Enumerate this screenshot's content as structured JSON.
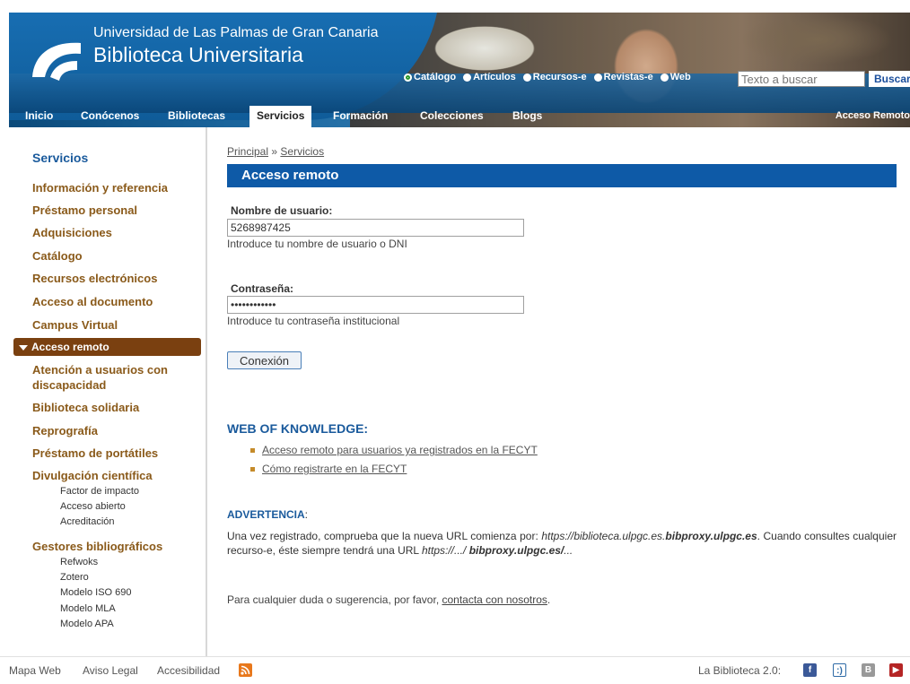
{
  "header": {
    "university": "Universidad de Las Palmas de Gran Canaria",
    "library": "Biblioteca Universitaria",
    "search_options": [
      "Catálogo",
      "Artículos",
      "Recursos-e",
      "Revistas-e",
      "Web"
    ],
    "selected_option": "Catálogo",
    "search_placeholder": "Texto a buscar",
    "search_button": "Buscar",
    "nav": [
      "Inicio",
      "Conócenos",
      "Bibliotecas",
      "Servicios",
      "Formación",
      "Colecciones",
      "Blogs"
    ],
    "active_nav": "Servicios",
    "remote_access_link": "Acceso Remoto"
  },
  "sidebar": {
    "title": "Servicios",
    "items": [
      "Información y referencia",
      "Préstamo personal",
      "Adquisiciones",
      "Catálogo",
      "Recursos electrónicos",
      "Acceso al documento",
      "Campus Virtual",
      "Acceso remoto",
      "Atención a usuarios con",
      "discapacidad",
      "Biblioteca solidaria",
      "Reprografía",
      "Préstamo de portátiles",
      "Divulgación científica",
      "Gestores bibliográficos"
    ],
    "divulgacion_sub": [
      "Factor de impacto",
      "Acceso abierto",
      "Acreditación"
    ],
    "gestores_sub": [
      "Refwoks",
      "Zotero",
      "Modelo ISO 690",
      "Modelo MLA",
      "Modelo APA"
    ]
  },
  "main": {
    "breadcrumb_home": "Principal",
    "breadcrumb_sep": "»",
    "breadcrumb_current": "Servicios",
    "title": "Acceso remoto",
    "username_label": "Nombre de usuario:",
    "username_value": "5268987425",
    "username_hint": "Introduce tu nombre de usuario o DNI",
    "password_label": "Contraseña:",
    "password_value": "••••••••••••",
    "password_hint": "Introduce tu contraseña institucional",
    "login_button": "Conexión",
    "wok_heading": "WEB OF KNOWLEDGE:",
    "wok_links": [
      "Acceso remoto para usuarios ya registrados en la FECYT",
      "Cómo registrarte en la FECYT"
    ],
    "warning_heading": "ADVERTENCIA",
    "warning_colon": ":",
    "warning_p1": "Una vez registrado, comprueba que la nueva URL comienza por: ",
    "warning_url1": "https://biblioteca.ulpgc.es.",
    "warning_url1_bold": "bibproxy.ulpgc.es",
    "warning_p2": ". Cuando consultes cualquier recurso-e, éste siempre tendrá una URL ",
    "warning_url2": "https://.../ ",
    "warning_url2_bold": "bibproxy.ulpgc.es/",
    "warning_url2_end": "...",
    "contact_prefix": "Para cualquier duda o sugerencia, por favor, ",
    "contact_link": "contacta con nosotros",
    "contact_suffix": "."
  },
  "footer": {
    "links": [
      "Mapa Web",
      "Aviso Legal",
      "Accesibilidad"
    ],
    "biblioteca20": "La Biblioteca 2.0:",
    "social": [
      "facebook-icon",
      "tuenti-icon",
      "blogger-icon",
      "youtube-icon"
    ]
  },
  "colors": {
    "accent_blue": "#0e5aa7",
    "sidebar_link": "#8a5a1a",
    "sidebar_active": "#7a4010"
  }
}
